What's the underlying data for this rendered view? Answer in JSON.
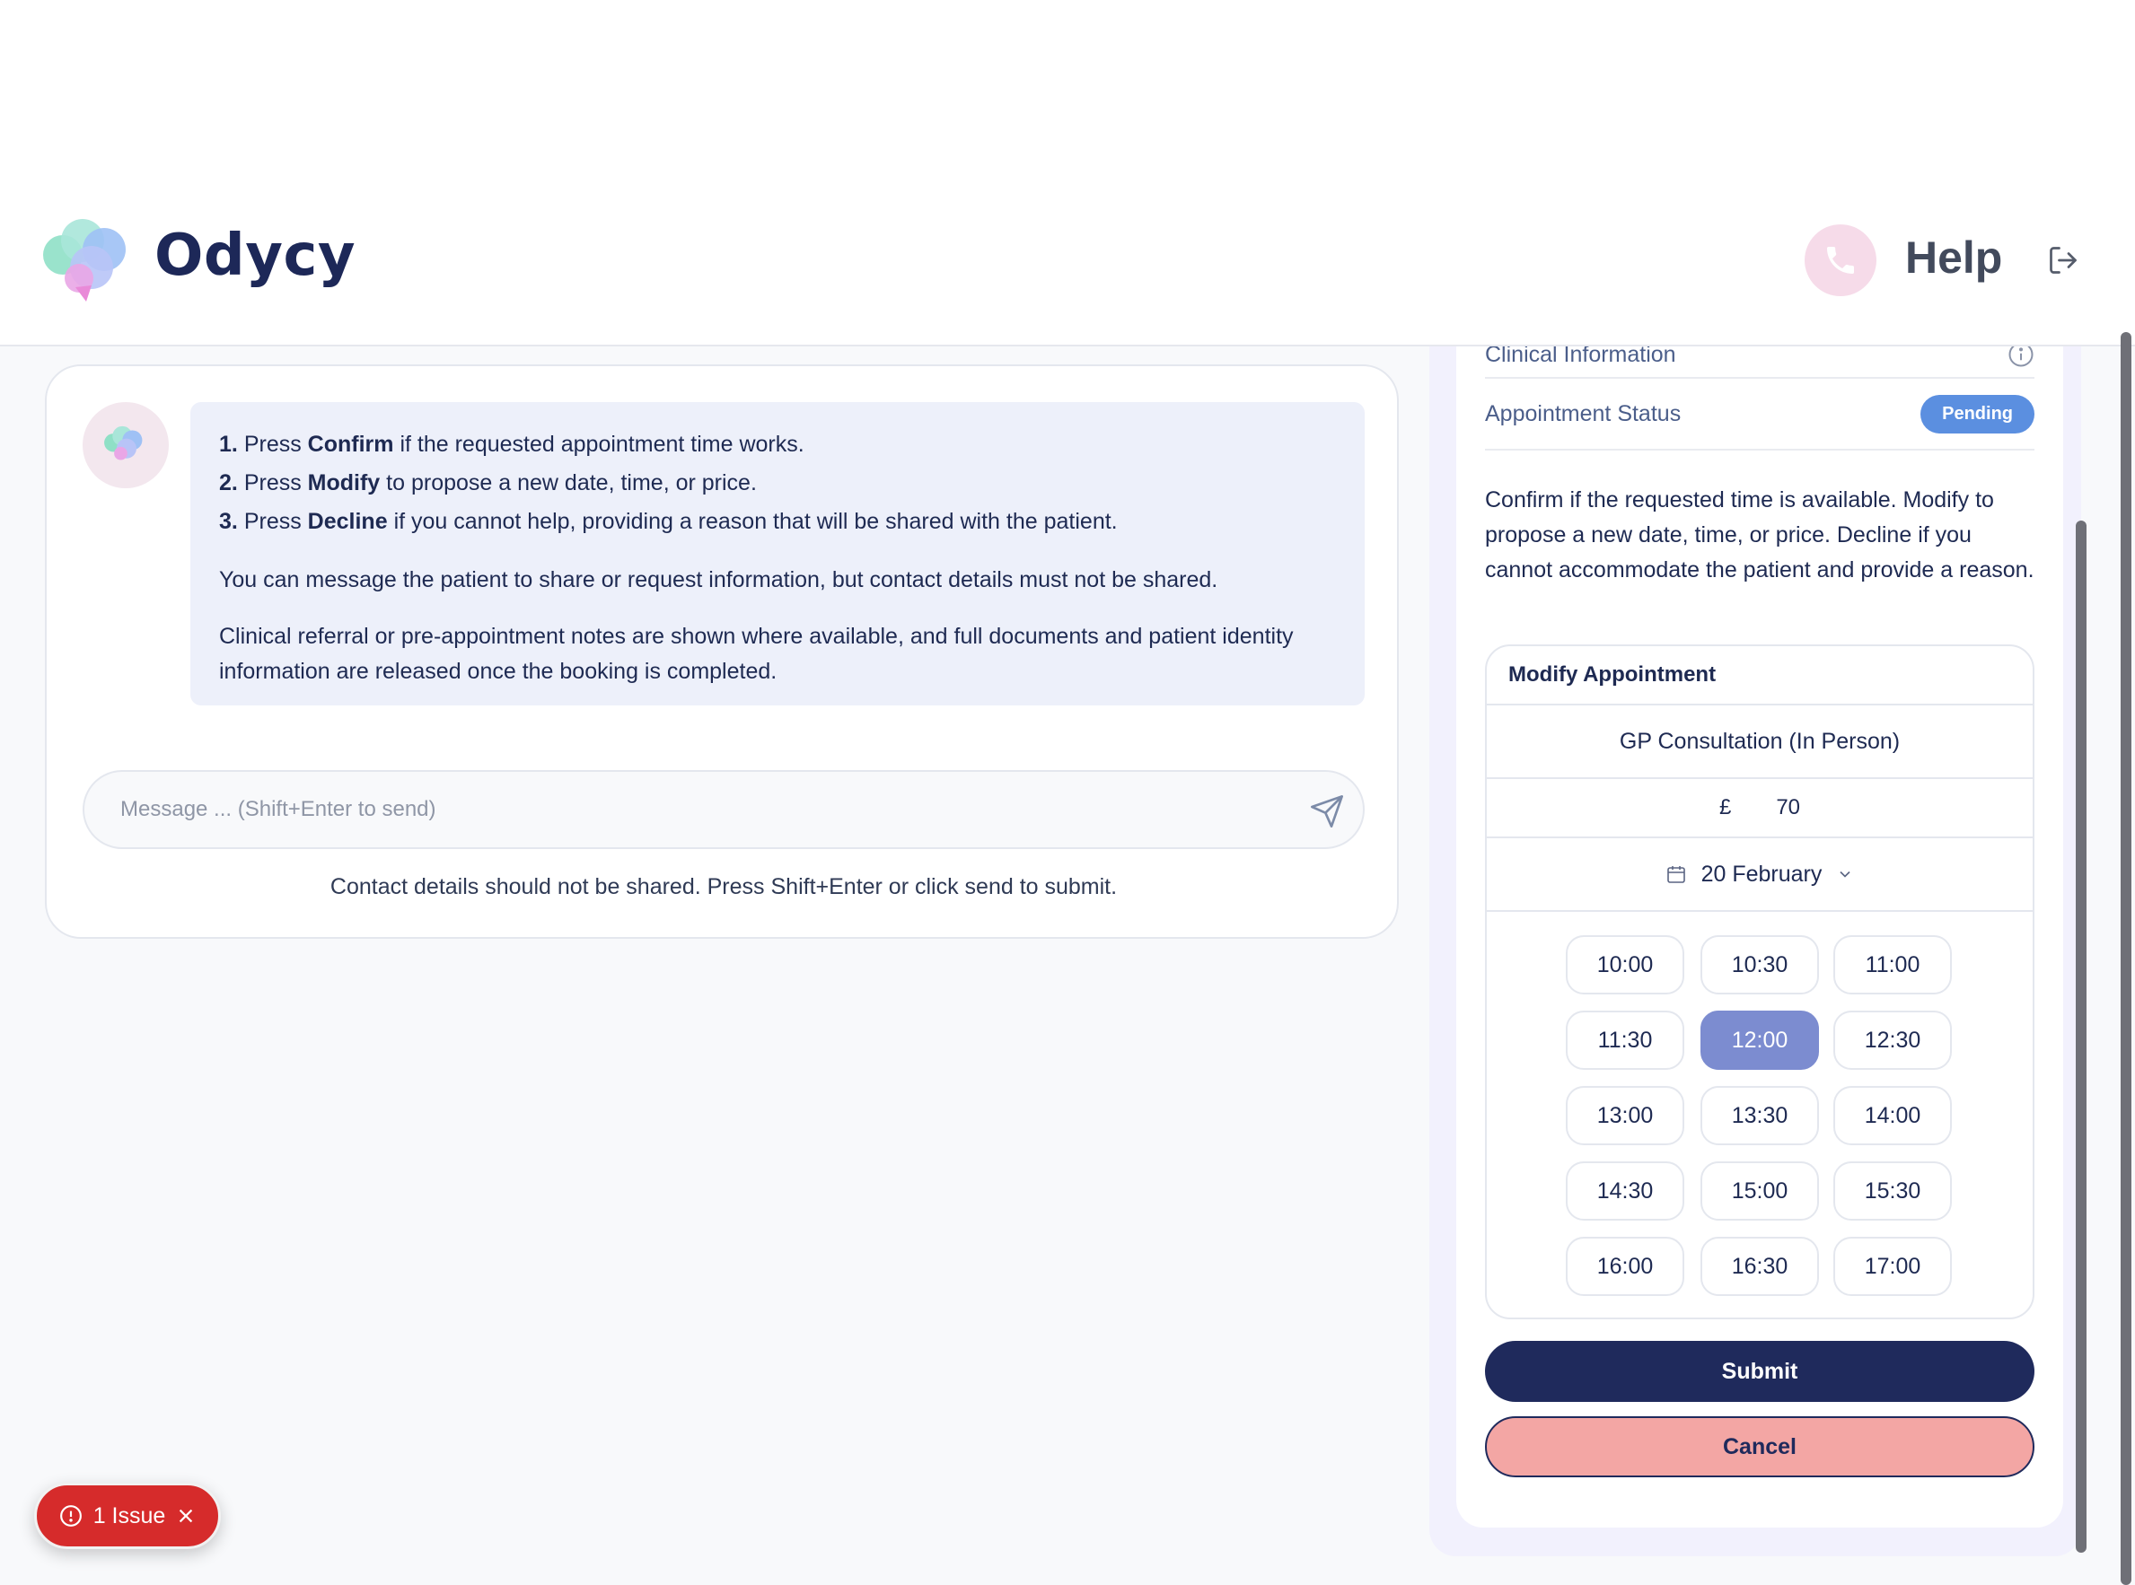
{
  "brand": {
    "name": "Odycy"
  },
  "header": {
    "help_label": "Help"
  },
  "chat": {
    "instructions": {
      "item1_num": "1.",
      "item1_pre": "Press",
      "item1_bold": "Confirm",
      "item1_post": "if the requested appointment time works.",
      "item2_num": "2.",
      "item2_pre": "Press",
      "item2_bold": "Modify",
      "item2_post": "to propose a new date, time, or price.",
      "item3_num": "3.",
      "item3_pre": "Press",
      "item3_bold": "Decline",
      "item3_post": "if you cannot help, providing a reason that will be shared with the patient.",
      "para1": "You can message the patient to share or request information, but contact details must not be shared.",
      "para2": "Clinical referral or pre-appointment notes are shown where available, and full documents and patient identity information are released once the booking is completed."
    },
    "input_placeholder": "Message ... (Shift+Enter to send)",
    "hint": "Contact details should not be shared. Press Shift+Enter or click send to submit."
  },
  "panel": {
    "clinical_label": "Clinical Information",
    "status_label": "Appointment Status",
    "status_value": "Pending",
    "description": "Confirm if the requested time is available. Modify to propose a new date, time, or price. Decline if you cannot accommodate the patient and provide a reason.",
    "modify": {
      "title": "Modify Appointment",
      "service": "GP Consultation (In Person)",
      "currency": "£",
      "price": "70",
      "date": "20 February",
      "slots": [
        "10:00",
        "10:30",
        "11:00",
        "11:30",
        "12:00",
        "12:30",
        "13:00",
        "13:30",
        "14:00",
        "14:30",
        "15:00",
        "15:30",
        "16:00",
        "16:30",
        "17:00"
      ],
      "selected_slot": "12:00"
    },
    "submit_label": "Submit",
    "cancel_label": "Cancel"
  },
  "issues": {
    "label": "1 Issue"
  },
  "colors": {
    "navy": "#1f2a5c",
    "accent": "#7c8cd0",
    "badge": "#5b8fe0",
    "issue": "#d62b2b",
    "cancel": "#f3a6a4"
  }
}
